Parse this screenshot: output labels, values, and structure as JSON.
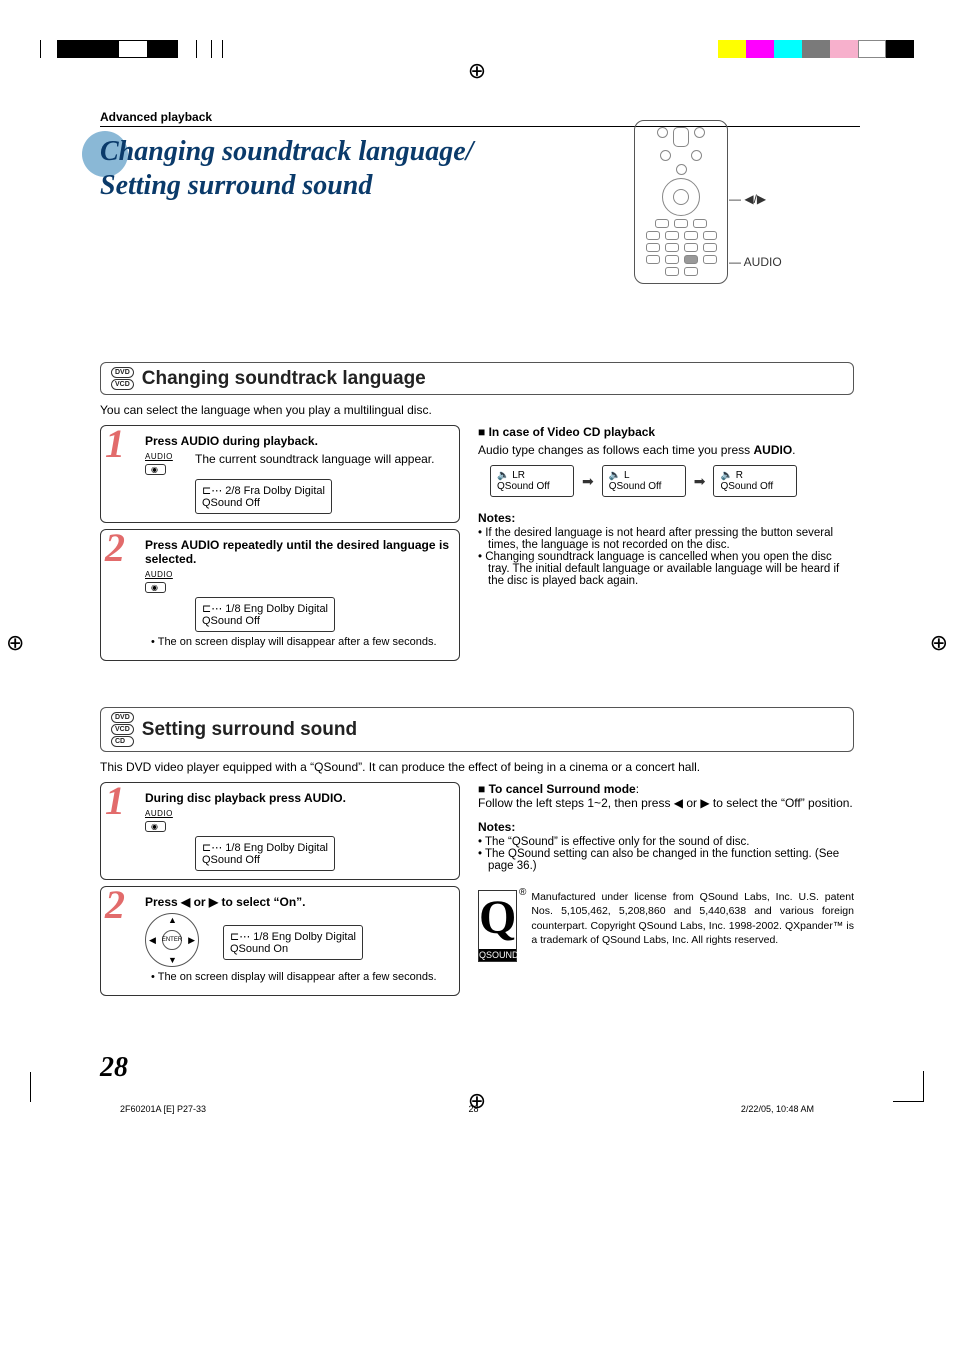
{
  "header": {
    "section_label": "Advanced playback"
  },
  "title": {
    "line1": "Changing soundtrack language/",
    "line2": "Setting surround sound"
  },
  "remote": {
    "callout_arrows": "◀/▶",
    "callout_audio": "AUDIO"
  },
  "section1": {
    "badges": [
      "DVD",
      "VCD"
    ],
    "heading": "Changing soundtrack language",
    "intro": "You can select the language when you play a multilingual disc.",
    "step1": {
      "num": "1",
      "title": "Press AUDIO during playback.",
      "audio_label": "AUDIO",
      "body": "The current soundtrack language will appear.",
      "osd_line1": "2/8 Fra Dolby Digital",
      "osd_line2": "QSound Off"
    },
    "step2": {
      "num": "2",
      "title": "Press AUDIO repeatedly until the desired language is selected.",
      "audio_label": "AUDIO",
      "osd_line1": "1/8 Eng Dolby Digital",
      "osd_line2": "QSound Off",
      "bullet": "The on screen display will disappear after a few seconds."
    },
    "right": {
      "heading": "In case of Video CD playback",
      "body_pre": "Audio type changes as follows each time you press ",
      "body_bold": "AUDIO",
      "body_post": ".",
      "box1_l1": "🔈 LR",
      "box1_l2": "QSound Off",
      "box2_l1": "🔈 L",
      "box2_l2": "QSound Off",
      "box3_l1": "🔈 R",
      "box3_l2": "QSound Off",
      "notes_h": "Notes:",
      "note1": "If the desired language is not heard after pressing the button several times, the language is not recorded on the disc.",
      "note2": "Changing soundtrack language is cancelled when you open the disc tray. The initial default language or available language will be heard if the disc is played back again."
    }
  },
  "section2": {
    "badges": [
      "DVD",
      "VCD",
      "CD"
    ],
    "heading": "Setting surround sound",
    "intro": "This DVD video player equipped with a “QSound”. It can produce the effect of being in a cinema or a concert hall.",
    "step1": {
      "num": "1",
      "title": "During disc playback press AUDIO.",
      "audio_label": "AUDIO",
      "osd_line1": "1/8 Eng Dolby Digital",
      "osd_line2": "QSound Off"
    },
    "step2": {
      "num": "2",
      "title": "Press ◀ or ▶ to select “On”.",
      "enter_label": "ENTER",
      "osd_line1": "1/8 Eng Dolby Digital",
      "osd_line2": "QSound On",
      "bullet": "The on screen display will disappear after a few seconds."
    },
    "right": {
      "cancel_h": "To cancel Surround mode",
      "cancel_body": "Follow the left steps 1~2, then press ◀ or ▶ to select the “Off” position.",
      "notes_h": "Notes:",
      "note1": "The “QSound” is effective only for the sound of disc.",
      "note2": "The QSound setting can also be changed in the function setting. (See page 36.)"
    },
    "qsound": {
      "logo_letter": "Q",
      "logo_bottom": "QSOUND",
      "reg": "®",
      "text": "Manufactured under license from QSound Labs, Inc. U.S. patent Nos. 5,105,462, 5,208,860 and 5,440,638 and various foreign counterpart. Copyright QSound Labs, Inc. 1998-2002. QXpander™ is a trademark of QSound Labs, Inc. All rights reserved."
    }
  },
  "page_number": "28",
  "footer": {
    "left": "2F60201A [E] P27-33",
    "center": "28",
    "right": "2/22/05, 10:48 AM"
  }
}
